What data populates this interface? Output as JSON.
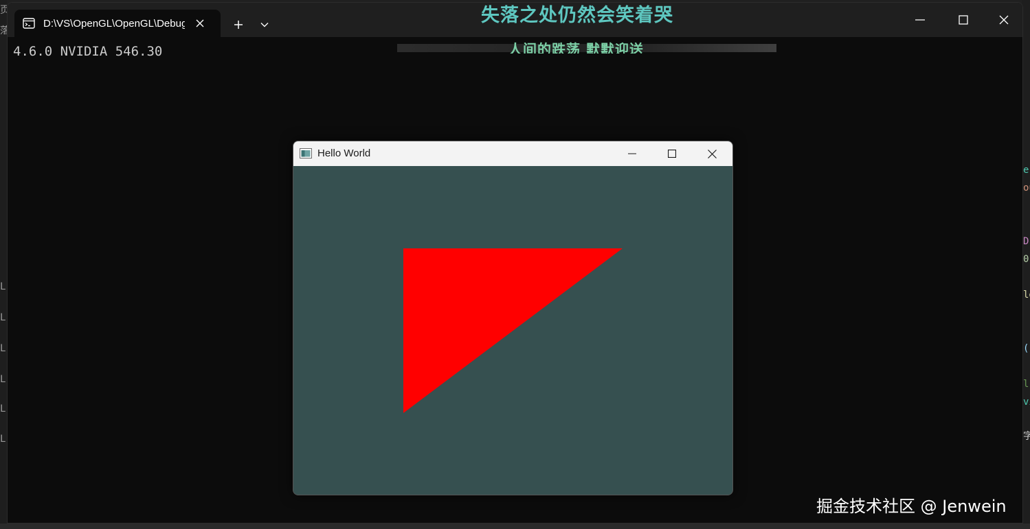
{
  "background": {
    "left_glyphs": [
      "页",
      "落",
      "L",
      "L",
      "L",
      "L",
      "L",
      "L"
    ],
    "right_glyphs": [
      {
        "text": "er",
        "color": "#4ec9b0"
      },
      {
        "text": "ou",
        "color": "#ce9178"
      },
      {
        "text": "D",
        "color": "#c586c0"
      },
      {
        "text": "0",
        "color": "#b5cea8"
      },
      {
        "text": "lo",
        "color": "#dcdcaa"
      },
      {
        "text": "(",
        "color": "#9cdcfe"
      },
      {
        "text": "l",
        "color": "#6a9955"
      },
      {
        "text": "vi",
        "color": "#4ec9b0"
      },
      {
        "text": "字",
        "color": "#cccccc"
      }
    ]
  },
  "terminal": {
    "tab_title": "D:\\VS\\OpenGL\\OpenGL\\Debug\\OpenGL.exe",
    "console_output": "4.6.0 NVIDIA 546.30",
    "icons": {
      "tab": "console-icon",
      "close": "close-icon",
      "new_tab": "plus-icon",
      "dropdown": "chevron-down-icon",
      "minimize": "minimize-icon",
      "maximize": "maximize-icon",
      "window_close": "close-icon"
    }
  },
  "overlay": {
    "lyric_line_1": "失落之处仍然会笑着哭",
    "lyric_line_2": "人间的跌荡 默默迎送",
    "colors": {
      "line1": "#5ec7c0",
      "line2": "#7ccfa6"
    }
  },
  "gl_window": {
    "title": "Hello World",
    "clear_color": "#365050",
    "triangle_color": "#ff0000"
  },
  "watermark": "掘金技术社区 @ Jenwein"
}
